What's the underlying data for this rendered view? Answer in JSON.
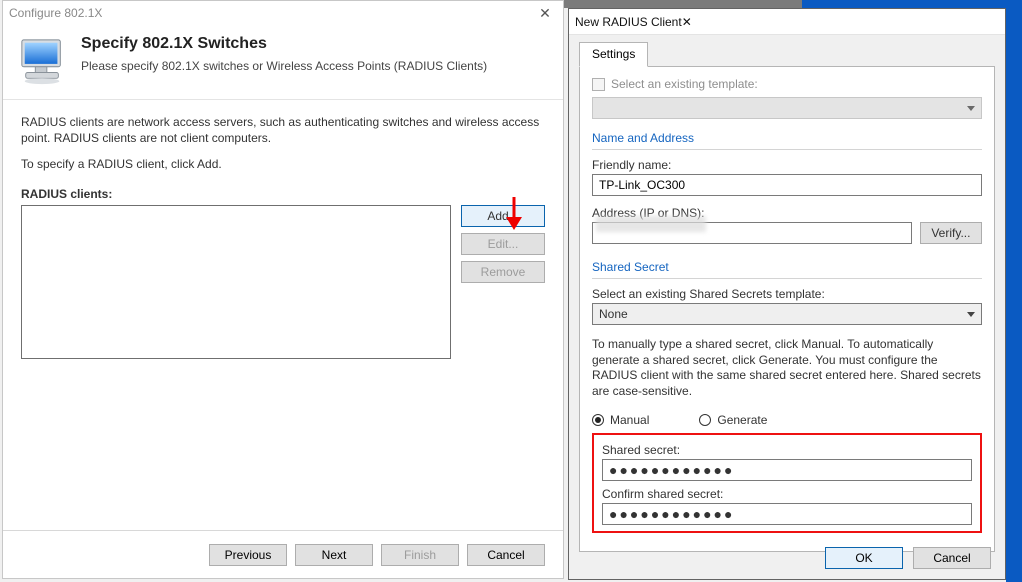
{
  "left": {
    "title": "Configure 802.1X",
    "heading": "Specify 802.1X Switches",
    "subheading": "Please specify 802.1X switches or Wireless Access Points (RADIUS Clients)",
    "paragraph1": "RADIUS clients are network access servers, such as authenticating switches and wireless access point. RADIUS clients are not client computers.",
    "paragraph2": "To specify a RADIUS client, click Add.",
    "clients_label": "RADIUS clients:",
    "buttons": {
      "add": "Add...",
      "edit": "Edit...",
      "remove": "Remove"
    },
    "footer": {
      "previous": "Previous",
      "next": "Next",
      "finish": "Finish",
      "cancel": "Cancel"
    }
  },
  "right": {
    "title": "New RADIUS Client",
    "tab": "Settings",
    "template_chk": "Select an existing template:",
    "group_name_addr": "Name and Address",
    "friendly_label": "Friendly name:",
    "friendly_value": "TP-Link_OC300",
    "address_label": "Address (IP or DNS):",
    "address_value": "",
    "verify": "Verify...",
    "group_secret": "Shared Secret",
    "secret_tmpl_label": "Select an existing Shared Secrets template:",
    "secret_tmpl_value": "None",
    "manual_help": "To manually type a shared secret, click Manual. To automatically generate a shared secret, click Generate. You must configure the RADIUS client with the same shared secret entered here. Shared secrets are case-sensitive.",
    "radio_manual": "Manual",
    "radio_generate": "Generate",
    "secret_label": "Shared secret:",
    "secret_value": "●●●●●●●●●●●●",
    "confirm_label": "Confirm shared secret:",
    "confirm_value": "●●●●●●●●●●●●",
    "ok": "OK",
    "cancel": "Cancel"
  }
}
